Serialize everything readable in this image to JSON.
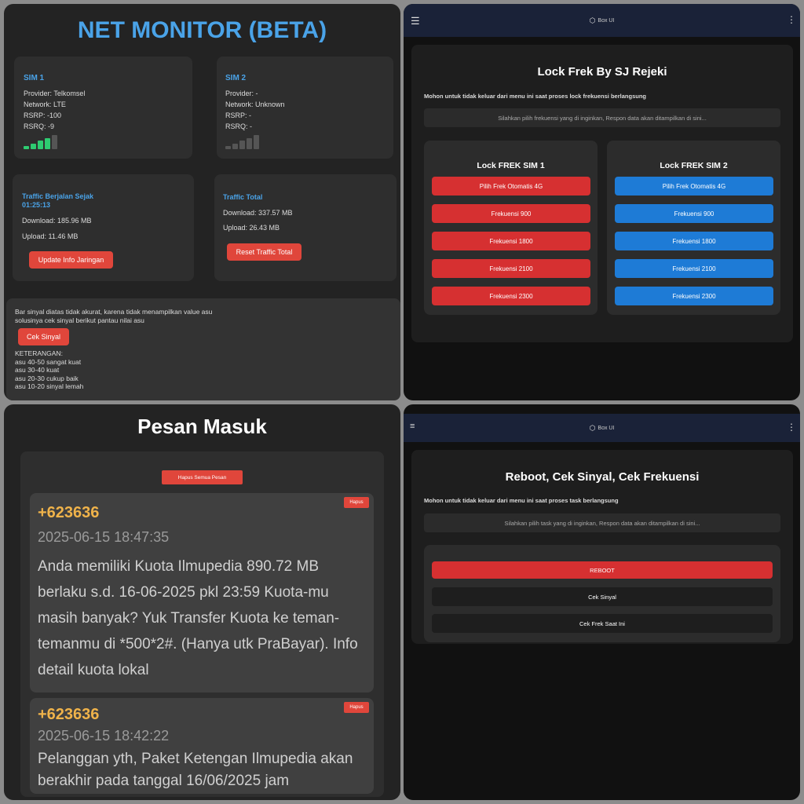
{
  "net_monitor": {
    "title": "NET MONITOR (BETA)",
    "sim1": {
      "title": "SIM 1",
      "provider": "Provider: Telkomsel",
      "network": "Network: LTE",
      "rsrp": "RSRP: -100",
      "rsrq": "RSRQ: -9",
      "signal_bars": 4,
      "signal_max": 5
    },
    "sim2": {
      "title": "SIM 2",
      "provider": "Provider: -",
      "network": "Network: Unknown",
      "rsrp": "RSRP: -",
      "rsrq": "RSRQ: -",
      "signal_bars": 0,
      "signal_max": 5
    },
    "traffic_since": {
      "title": "Traffic Berjalan Sejak",
      "time": "01:25:13",
      "download": "Download: 185.96 MB",
      "upload": "Upload: 11.46 MB",
      "button": "Update Info Jaringan"
    },
    "traffic_total": {
      "title": "Traffic Total",
      "download": "Download: 337.57 MB",
      "upload": "Upload: 26.43 MB",
      "button": "Reset Traffic Total"
    },
    "note": {
      "line1": "Bar sinyal diatas tidak akurat, karena tidak menampilkan value asu",
      "line2": "solusinya cek sinyal berikut pantau nilai asu",
      "button": "Cek Sinyal",
      "legend_title": "KETERANGAN:",
      "legend": [
        "asu 40-50 sangat kuat",
        "asu 30-40 kuat",
        "asu 20-30 cukup baik",
        "asu 10-20 sinyal lemah"
      ]
    }
  },
  "lock_frek": {
    "app_title": "Box UI",
    "title": "Lock Frek By SJ Rejeki",
    "warning": "Mohon untuk tidak keluar dari menu ini saat proses lock frekuensi berlangsung",
    "response": "Silahkan pilih frekuensi yang di inginkan, Respon data akan ditampilkan di sini...",
    "sim1": {
      "title": "Lock FREK SIM 1",
      "buttons": [
        "Pilih Frek Otomatis 4G",
        "Frekuensi 900",
        "Frekuensi 1800",
        "Frekuensi 2100",
        "Frekuensi 2300"
      ]
    },
    "sim2": {
      "title": "Lock FREK SIM 2",
      "buttons": [
        "Pilih Frek Otomatis 4G",
        "Frekuensi 900",
        "Frekuensi 1800",
        "Frekuensi 2100",
        "Frekuensi 2300"
      ]
    },
    "colors": {
      "sim1": "#d63031",
      "sim2": "#1e7bd6"
    }
  },
  "inbox": {
    "title": "Pesan Masuk",
    "delete_all": "Hapus Semua Pesan",
    "messages": [
      {
        "sender": "+623636",
        "date": "2025-06-15 18:47:35",
        "body": "Anda memiliki Kuota Ilmupedia 890.72 MB berlaku s.d. 16-06-2025 pkl 23:59 Kuota-mu masih banyak? Yuk Transfer Kuota ke teman-temanmu di *500*2#. (Hanya utk PraBayar). Info detail kuota lokal",
        "delete": "Hapus"
      },
      {
        "sender": "+623636",
        "date": "2025-06-15 18:42:22",
        "body": "Pelanggan yth, Paket Ketengan Ilmupedia akan berakhir pada tanggal 16/06/2025 jam",
        "delete": "Hapus"
      }
    ]
  },
  "tasks": {
    "app_title": "Box UI",
    "title": "Reboot, Cek Sinyal, Cek Frekuensi",
    "warning": "Mohon untuk tidak keluar dari menu ini saat proses task berlangsung",
    "response": "Silahkan pilih task yang di inginkan, Respon data akan ditampilkan di sini...",
    "buttons": [
      "REBOOT",
      "Cek Sinyal",
      "Cek Frek Saat Ini"
    ]
  }
}
